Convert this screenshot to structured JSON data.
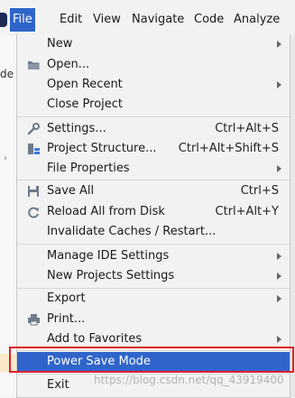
{
  "menubar": {
    "items": [
      "File",
      "Edit",
      "View",
      "Navigate",
      "Code",
      "Analyze"
    ],
    "active": "File"
  },
  "editor": {
    "left_fragment": "de"
  },
  "file_menu": {
    "new": "New",
    "open": "Open...",
    "open_recent": "Open Recent",
    "close_project": "Close Project",
    "settings": "Settings...",
    "settings_shortcut": "Ctrl+Alt+S",
    "project_structure": "Project Structure...",
    "project_structure_shortcut": "Ctrl+Alt+Shift+S",
    "file_properties": "File Properties",
    "save_all": "Save All",
    "save_all_shortcut": "Ctrl+S",
    "reload_all": "Reload All from Disk",
    "reload_all_shortcut": "Ctrl+Alt+Y",
    "invalidate_caches": "Invalidate Caches / Restart...",
    "manage_ide_settings": "Manage IDE Settings",
    "new_projects_settings": "New Projects Settings",
    "export": "Export",
    "print": "Print...",
    "add_to_favorites": "Add to Favorites",
    "power_save_mode": "Power Save Mode",
    "exit": "Exit"
  },
  "watermark": "https://blog.csdn.net/qq_43919400",
  "colors": {
    "selection": "#2f65ca",
    "highlight_box": "#e0212a",
    "background": "#f2f2f2"
  }
}
